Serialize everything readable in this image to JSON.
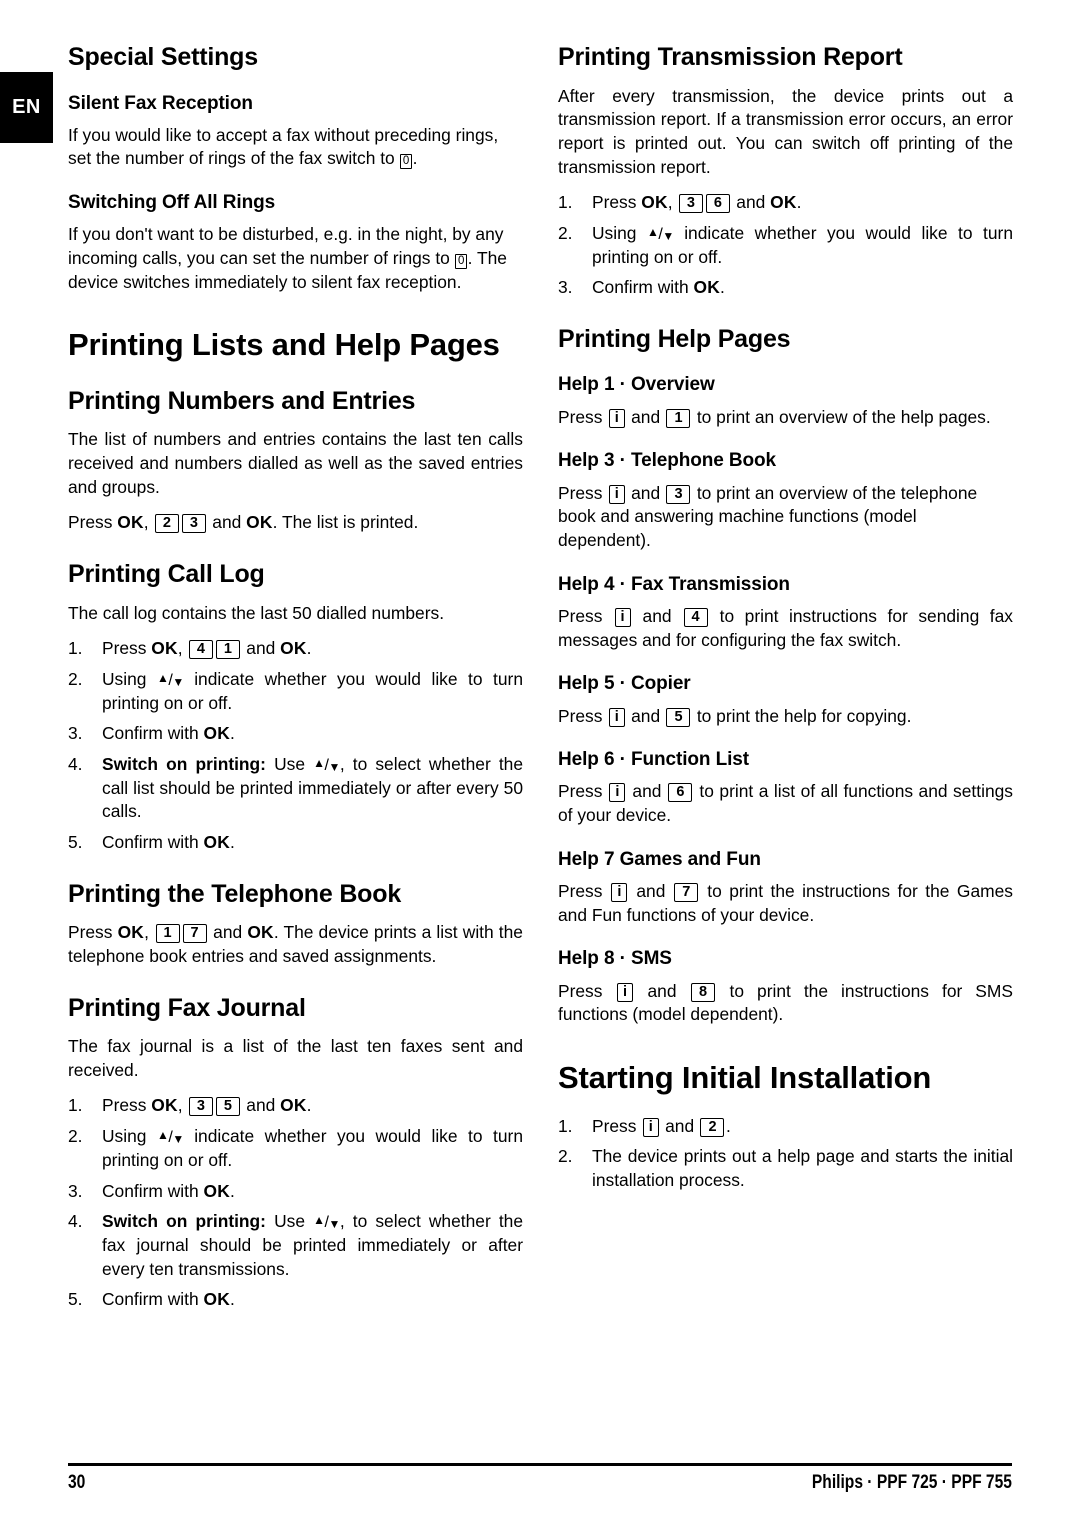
{
  "page": {
    "language_tab": "EN",
    "number": "30",
    "footer_model": "Philips · PPF 725 · PPF 755"
  },
  "keys": {
    "ok": "OK",
    "info": "i",
    "zero": "0",
    "one": "1",
    "two": "2",
    "three": "3",
    "four": "4",
    "five": "5",
    "six": "6",
    "seven": "7",
    "eight": "8",
    "up": "▲",
    "slash": "/",
    "down": "▼"
  },
  "left_column": {
    "special_settings": {
      "heading": "Special Settings",
      "silent_fax": {
        "heading": "Silent Fax Reception",
        "body_1": "If you would like to accept a fax without preceding rings, set the number of rings of the fax switch to ",
        "body_2": "."
      },
      "switching_off": {
        "heading": "Switching Off All Rings",
        "body_1": "If you don't want to be disturbed, e.g. in the night, by any incoming calls, you can set the number of rings to ",
        "body_2": ". The device switches immediately to silent fax reception."
      }
    },
    "printing_lists": {
      "heading": "Printing Lists and Help Pages",
      "numbers_entries": {
        "heading": "Printing Numbers and Entries",
        "body": "The list of numbers and entries contains the last ten calls received and numbers dialled as well as the saved entries and groups.",
        "press_prefix": "Press ",
        "press_comma": ", ",
        "press_and": " and ",
        "press_suffix": ". The list is printed."
      },
      "call_log": {
        "heading": "Printing Call Log",
        "body": "The call log contains the last 50 dialled numbers.",
        "steps": [
          {
            "num": "1.",
            "text_a": "Press ",
            "text_b": ", ",
            "text_c": " and ",
            "text_d": "."
          },
          {
            "num": "2.",
            "text_a": "Using ",
            "text_b": " indicate whether you would like to turn printing on or off."
          },
          {
            "num": "3.",
            "text_a": "Confirm with ",
            "text_b": "."
          },
          {
            "num": "4.",
            "bold": "Switch on printing:",
            "text_a": " Use ",
            "text_b": ", to select whether the call list should be printed immediately or after every 50 calls."
          },
          {
            "num": "5.",
            "text_a": "Confirm with ",
            "text_b": "."
          }
        ]
      },
      "telephone_book": {
        "heading": "Printing the Telephone Book",
        "press_prefix": "Press ",
        "press_comma": ", ",
        "press_and": " and ",
        "press_suffix": ". The device prints a list with the telephone book entries and saved assignments."
      },
      "fax_journal": {
        "heading": "Printing Fax Journal",
        "body": "The fax journal is a list of the last ten faxes sent and received.",
        "steps": [
          {
            "num": "1.",
            "text_a": "Press ",
            "text_b": ", ",
            "text_c": " and ",
            "text_d": "."
          },
          {
            "num": "2.",
            "text_a": "Using ",
            "text_b": " indicate whether you would like to turn printing on or off."
          },
          {
            "num": "3.",
            "text_a": "Confirm with ",
            "text_b": "."
          },
          {
            "num": "4.",
            "bold": "Switch on printing:",
            "text_a": " Use ",
            "text_b": ", to select whether the fax journal should be printed immediately or after every ten transmissions."
          },
          {
            "num": "5.",
            "text_a": "Confirm with ",
            "text_b": "."
          }
        ]
      }
    }
  },
  "right_column": {
    "transmission_report": {
      "heading": "Printing Transmission Report",
      "body": "After every transmission, the device prints out a transmission report. If a transmission error occurs, an error report is printed out. You can switch off printing of the transmission report.",
      "steps": [
        {
          "num": "1.",
          "text_a": "Press ",
          "text_b": ", ",
          "text_c": " and ",
          "text_d": "."
        },
        {
          "num": "2.",
          "text_a": "Using ",
          "text_b": " indicate whether you would like to turn printing on or off."
        },
        {
          "num": "3.",
          "text_a": "Confirm with ",
          "text_b": "."
        }
      ]
    },
    "help_pages": {
      "heading": "Printing Help Pages",
      "items": [
        {
          "heading": "Help 1 · Overview",
          "text_a": "Press ",
          "text_b": " and ",
          "text_c": " to print an overview of the help pages.",
          "key": "1"
        },
        {
          "heading": "Help 3 · Telephone Book",
          "text_a": "Press ",
          "text_b": " and ",
          "text_c": " to print an overview of the telephone book and answering machine functions (model dependent).",
          "key": "3"
        },
        {
          "heading": "Help 4 · Fax Transmission",
          "text_a": "Press ",
          "text_b": " and ",
          "text_c": " to print instructions for sending fax messages and for configuring the fax switch.",
          "key": "4"
        },
        {
          "heading": "Help 5 · Copier",
          "text_a": "Press ",
          "text_b": " and ",
          "text_c": " to print the help for copying.",
          "key": "5"
        },
        {
          "heading": "Help 6 · Function List",
          "text_a": "Press ",
          "text_b": " and ",
          "text_c": " to print a list of all functions and settings of your device.",
          "key": "6"
        },
        {
          "heading": "Help 7 Games and Fun",
          "text_a": "Press ",
          "text_b": " and ",
          "text_c": " to print the instructions for the Games and Fun functions of your device.",
          "key": "7"
        },
        {
          "heading": "Help 8 · SMS",
          "text_a": "Press ",
          "text_b": " and ",
          "text_c": " to print the instructions for SMS functions (model dependent).",
          "key": "8"
        }
      ]
    },
    "initial_installation": {
      "heading": "Starting Initial Installation",
      "steps": [
        {
          "num": "1.",
          "text_a": "Press ",
          "text_b": " and ",
          "text_c": "."
        },
        {
          "num": "2.",
          "text_a": "The device prints out a help page and starts the initial installation process."
        }
      ]
    }
  }
}
